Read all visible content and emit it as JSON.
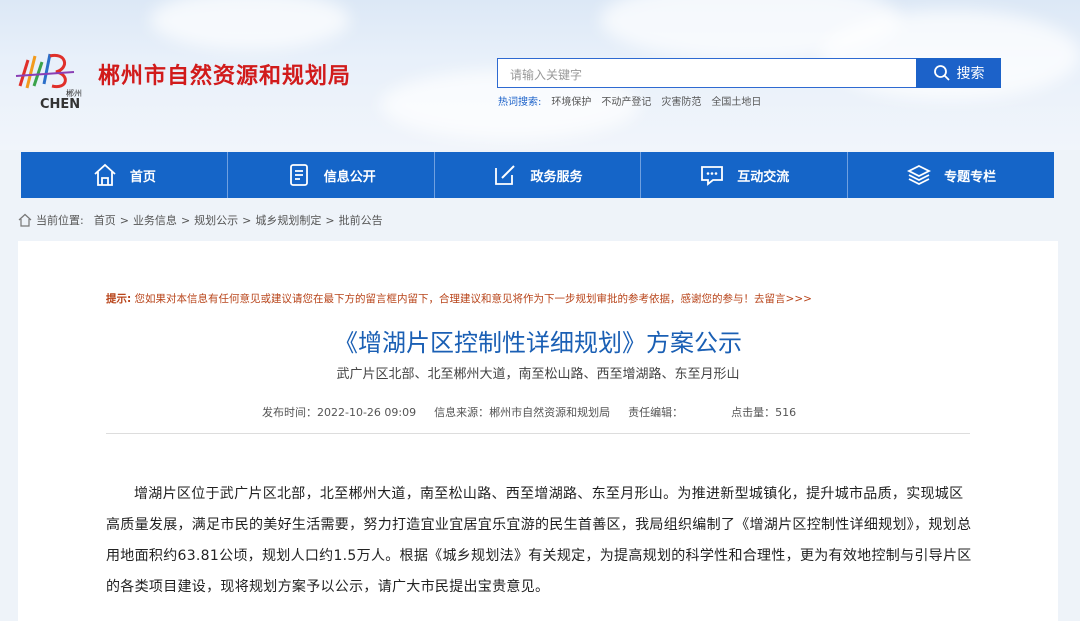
{
  "header": {
    "logo_text_top": "郴州",
    "logo_text_bottom": "CHEN",
    "site_title": "郴州市自然资源和规划局",
    "search_placeholder": "请输入关键字",
    "search_button": "搜索",
    "hot_label": "热词搜索:",
    "hot_words": [
      "环境保护",
      "不动产登记",
      "灾害防范",
      "全国土地日"
    ]
  },
  "nav": [
    {
      "label": "首页",
      "icon": "home-icon"
    },
    {
      "label": "信息公开",
      "icon": "document-icon"
    },
    {
      "label": "政务服务",
      "icon": "edit-icon"
    },
    {
      "label": "互动交流",
      "icon": "chat-icon"
    },
    {
      "label": "专题专栏",
      "icon": "layers-icon"
    }
  ],
  "breadcrumb": {
    "label": "当前位置:",
    "items": [
      "首页",
      "业务信息",
      "规划公示",
      "城乡规划制定",
      "批前公告"
    ],
    "separator": ">"
  },
  "article": {
    "tip_label": "提示:",
    "tip_text": "您如果对本信息有任何意见或建议请您在最下方的留言框内留下，合理建议和意见将作为下一步规划审批的参考依据，感谢您的参与！去留言>>>",
    "title": "《增湖片区控制性详细规划》方案公示",
    "subtitle": "武广片区北部、北至郴州大道，南至松山路、西至增湖路、东至月形山",
    "publish_time": "发布时间：2022-10-26 09:09",
    "source": "信息来源：郴州市自然资源和规划局",
    "editor": "责任编辑：",
    "clicks": "点击量：516",
    "body": "增湖片区位于武广片区北部，北至郴州大道，南至松山路、西至增湖路、东至月形山。为推进新型城镇化，提升城市品质，实现城区高质量发展，满足市民的美好生活需要，努力打造宜业宜居宜乐宜游的民生首善区，我局组织编制了《增湖片区控制性详细规划》，规划总用地面积约63.81公顷，规划人口约1.5万人。根据《城乡规划法》有关规定，为提高规划的科学性和合理性，更为有效地控制与引导片区的各类项目建设，现将规划方案予以公示，请广大市民提出宝贵意见。"
  },
  "colors": {
    "brand_red": "#d11b1b",
    "nav_blue": "#1565c8",
    "title_blue": "#1a5fb4",
    "tip_orange": "#b8441a"
  }
}
